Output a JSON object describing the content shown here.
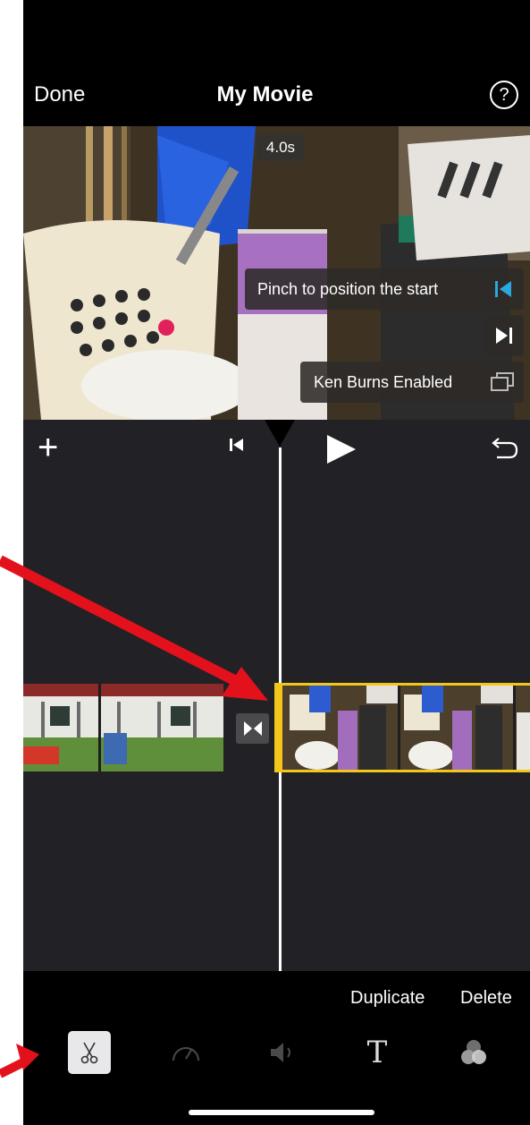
{
  "nav": {
    "done_label": "Done",
    "title": "My Movie",
    "help_label": "?"
  },
  "preview": {
    "duration": "4.0s",
    "pinch_hint": "Pinch to position the start",
    "ken_burns_label": "Ken Burns Enabled"
  },
  "timeline_toolbar": {
    "add_label": "+",
    "icons": [
      "add-icon",
      "skip-to-start-icon",
      "play-icon",
      "undo-icon"
    ]
  },
  "actions": {
    "duplicate_label": "Duplicate",
    "delete_label": "Delete"
  },
  "tools": {
    "text_glyph": "T",
    "icons": [
      "scissors-icon",
      "speed-icon",
      "volume-icon",
      "text-icon",
      "filters-icon"
    ]
  },
  "colors": {
    "selection": "#f2c719",
    "arrow": "#e3111b",
    "timeline_bg": "#222226"
  }
}
